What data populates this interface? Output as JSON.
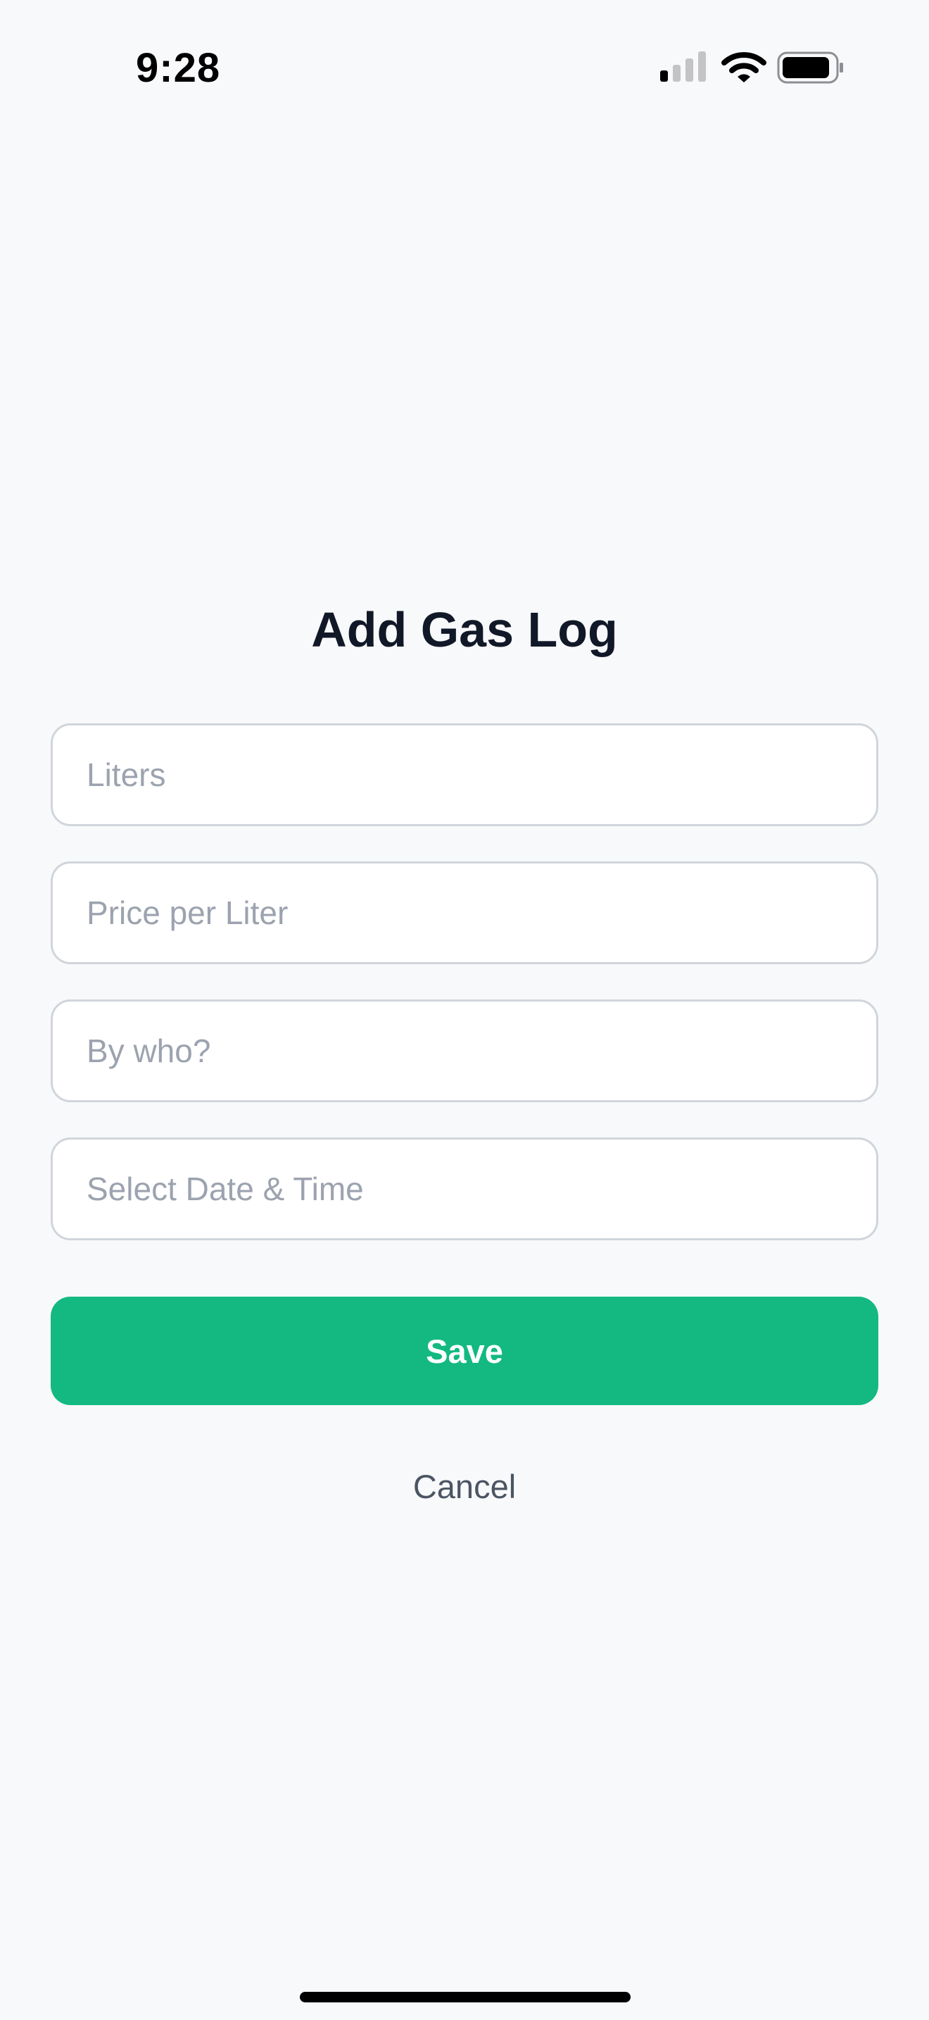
{
  "status_bar": {
    "time": "9:28",
    "icons": [
      "signal-icon",
      "wifi-icon",
      "battery-icon"
    ]
  },
  "form": {
    "title": "Add Gas Log",
    "fields": [
      {
        "name": "liters",
        "value": "",
        "placeholder": "Liters"
      },
      {
        "name": "price_per_liter",
        "value": "",
        "placeholder": "Price per Liter"
      },
      {
        "name": "by_who",
        "value": "",
        "placeholder": "By who?"
      },
      {
        "name": "date_time",
        "value": "",
        "placeholder": "Select Date & Time"
      }
    ],
    "save_label": "Save",
    "cancel_label": "Cancel"
  },
  "colors": {
    "background": "#f8f9fb",
    "accent": "#13b981",
    "title": "#111827",
    "placeholder": "#9ca3af",
    "cancel": "#4b5563",
    "field_border": "#d1d5db"
  }
}
